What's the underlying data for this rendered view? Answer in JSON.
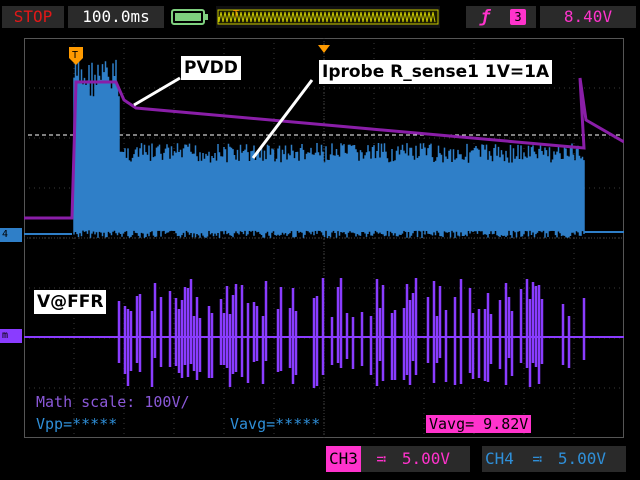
{
  "status": {
    "run_state": "STOP",
    "timebase": "100.0ms"
  },
  "trigger": {
    "channel": "3",
    "level": "8.40V",
    "marker": "T"
  },
  "colors": {
    "ch3": "#ff33cc",
    "ch4": "#2f7fc8",
    "ch2": "#8a1ea8",
    "math": "#8a3cff",
    "accent": "#e01818"
  },
  "annotations": {
    "pvdd": "PVDD",
    "iprobe": "Iprobe R_sense1 1V=1A",
    "vffr": "V@FFR"
  },
  "markers": {
    "ch_left_top": "4",
    "ch_left_mid": "m"
  },
  "measurements": {
    "math_scale": "Math scale: 100V/",
    "vpp": "Vpp=*****",
    "vavg_blue": "Vavg=*****",
    "vavg_pink": "Vavg= 9.82V"
  },
  "channels": [
    {
      "label": "CH3",
      "scale": "5.00V",
      "coupling": "dc"
    },
    {
      "label": "CH4",
      "scale": "5.00V",
      "coupling": "dc"
    }
  ],
  "icons": {
    "battery": "battery-icon",
    "trigger_edge": "rising-edge-icon",
    "trigger_source": "trigger-source-icon"
  }
}
